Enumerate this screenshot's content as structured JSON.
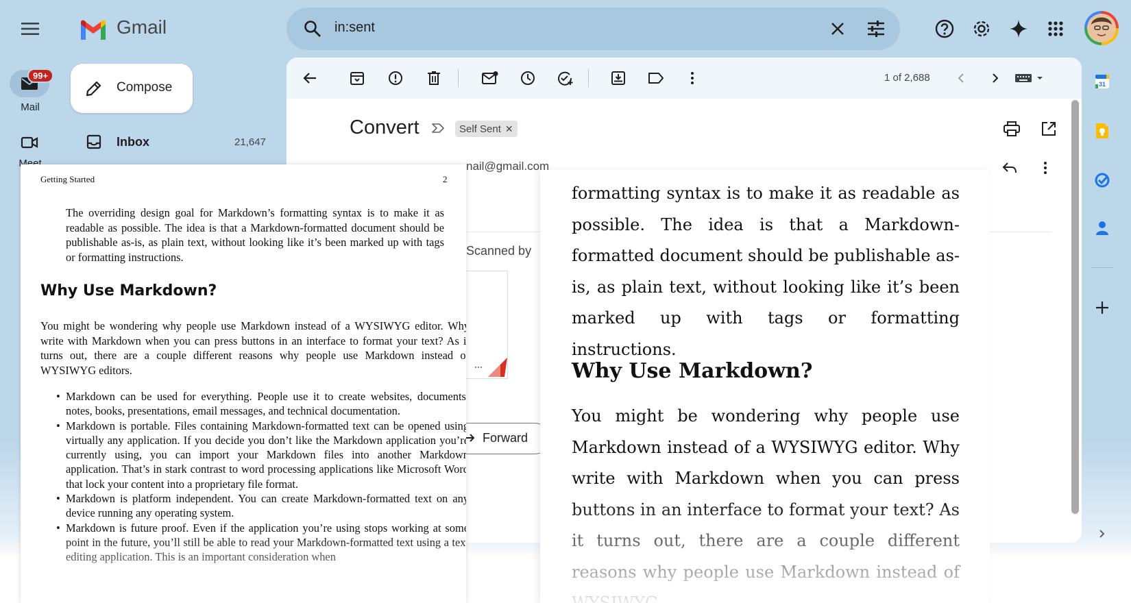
{
  "app": {
    "name": "Gmail"
  },
  "colors": {
    "app_bg": "#bcd6ea",
    "search_bg": "#a8c8e0",
    "badge_red": "#c5221f"
  },
  "search": {
    "query": "in:sent"
  },
  "rail": {
    "mail_label": "Mail",
    "mail_badge": "99+",
    "meet_label": "Meet"
  },
  "compose": {
    "label": "Compose"
  },
  "inbox": {
    "label": "Inbox",
    "count": "21,647"
  },
  "toolbar": {
    "page_count": "1 of 2,688"
  },
  "message": {
    "subject": "Convert",
    "label_chip": "Self Sent",
    "sender_email_fragment": "nail@gmail.com",
    "scanned_fragment": "Scanned by",
    "forward_label": "Forward"
  },
  "side_icons": [
    "calendar-icon",
    "keep-icon",
    "tasks-icon",
    "contacts-icon",
    "add-icon"
  ],
  "pdf": {
    "header": "Getting Started",
    "page_number": "2",
    "paragraph1": "The overriding design goal for Markdown’s formatting syntax is to make it as readable as possible. The idea is that a Markdown-formatted document should be publishable as-is, as plain text, without looking like it’s been marked up with tags or formatting instructions.",
    "heading": "Why Use Markdown?",
    "paragraph2": "You might be wondering why people use Markdown instead of a WYSIWYG editor. Why write with Markdown when you can press buttons in an interface to format your text? As it turns out, there are a couple different reasons why people use Markdown instead of WYSIWYG editors.",
    "bullets": [
      "Markdown can be used for everything. People use it to create websites, documents, notes, books, presentations, email messages, and technical documentation.",
      "Markdown is portable. Files containing Markdown-formatted text can be opened using virtually any application. If you decide you don’t like the Markdown application you’re currently using, you can import your Markdown files into another Markdown application. That’s in stark contrast to word processing applications like Microsoft Word that lock your content into a proprietary file format.",
      "Markdown is platform independent. You can create Markdown-formatted text on any device running any operating system.",
      "Markdown is future proof. Even if the application you’re using stops working at some point in the future, you’ll still be able to read your Markdown-formatted text using a text editing application. This is an important consideration when"
    ]
  },
  "zoom": {
    "paragraph1": "formatting syntax is to make it as readable as possible. The idea is that a Markdown-formatted document should be publishable as-is, as plain text, without looking like it’s been marked up with tags or formatting instructions.",
    "heading": "Why Use Markdown?",
    "paragraph2": "You might be wondering why people use Markdown instead of a WYSIWYG editor. Why write with Markdown when you can press buttons in an interface to format your text? As it turns out, there are a couple different reasons why people use Markdown instead of WYSIWYG"
  }
}
